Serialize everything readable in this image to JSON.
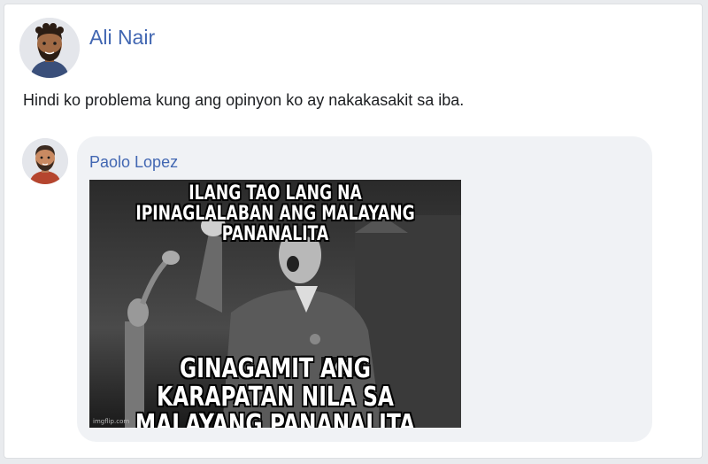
{
  "post": {
    "author": "Ali Nair",
    "avatar_icon": "bearded-man-avatar-icon",
    "text": "Hindi ko problema kung ang opinyon ko ay nakakasakit sa iba."
  },
  "comment": {
    "author": "Paolo Lopez",
    "avatar_icon": "man-avatar-icon",
    "meme": {
      "top_text": "ILANG TAO LANG NA IPINAGLALABAN ANG MALAYANG PANANALITA",
      "bottom_text": "GINAGAMIT ANG KARAPATAN NILA SA MALAYANG PANANALITA",
      "watermark": "imgflip.com"
    }
  },
  "colors": {
    "author_link": "#4267b2",
    "bubble_bg": "#f0f2f5",
    "text": "#1c1e21"
  }
}
